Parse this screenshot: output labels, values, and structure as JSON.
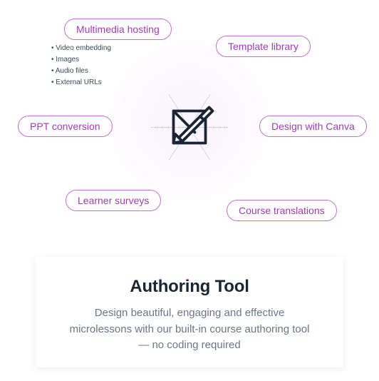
{
  "diagram": {
    "features": {
      "multimedia": "Multimedia hosting",
      "template": "Template library",
      "ppt": "PPT conversion",
      "canva": "Design with Canva",
      "surveys": "Learner surveys",
      "translations": "Course translations"
    },
    "multimedia_sub": [
      "Video embedding",
      "Images",
      "Audio files",
      "External URLs"
    ]
  },
  "card": {
    "title": "Authoring Tool",
    "description": "Design beautiful, engaging and effective microlessons with our built-in course authoring tool — no coding required"
  }
}
